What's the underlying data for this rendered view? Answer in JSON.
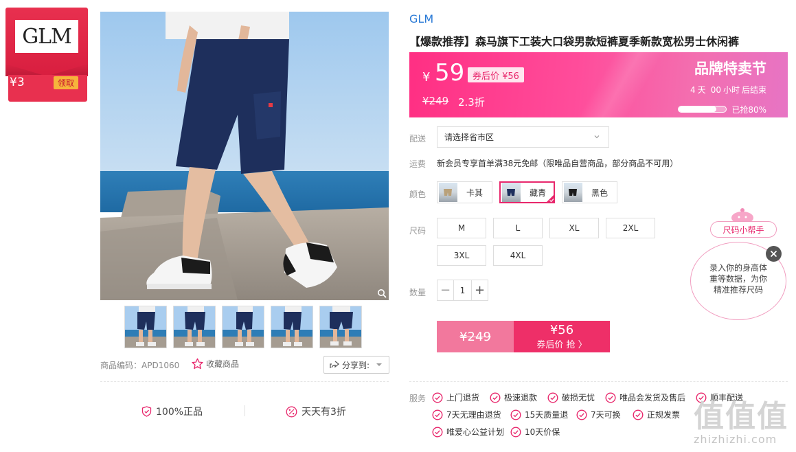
{
  "brand_card": {
    "logo_text": "GLM",
    "coupon_amount": "¥3",
    "coupon_button": "领取"
  },
  "gallery": {
    "thumb_count": 5
  },
  "meta": {
    "product_code": "商品编码：APD1060",
    "favorite": "收藏商品",
    "share": "分享到:"
  },
  "guarantees": {
    "genuine": "100%正品",
    "daily_discount": "天天有3折"
  },
  "product": {
    "brand": "GLM",
    "title": "【爆款推荐】森马旗下工装大口袋男款短裤夏季新款宽松男士休闲裤"
  },
  "price": {
    "yen": "¥",
    "current": "59",
    "coupon_tag": "券后价 ¥56",
    "original": "¥249",
    "discount": "2.3折",
    "event_title": "品牌特卖节",
    "countdown_days": "4",
    "countdown_day_unit": "天",
    "countdown_hours": "00",
    "countdown_hour_unit": "小时",
    "countdown_suffix": "后结束",
    "sold_percent": 0.8,
    "sold_label": "已抢80%"
  },
  "labels": {
    "delivery": "配送",
    "shipping": "运费",
    "color": "颜色",
    "size": "尺码",
    "quantity": "数量",
    "service": "服务"
  },
  "delivery": {
    "placeholder": "请选择省市区"
  },
  "shipping": {
    "text": "新会员专享首单满38元免邮（限唯品自营商品，部分商品不可用）"
  },
  "colors": [
    {
      "label": "卡其",
      "selected": false
    },
    {
      "label": "藏青",
      "selected": true
    },
    {
      "label": "黑色",
      "selected": false
    }
  ],
  "sizes": [
    "M",
    "L",
    "XL",
    "2XL",
    "3XL",
    "4XL"
  ],
  "quantity": {
    "value": "1",
    "minus": "−",
    "plus": "+"
  },
  "buy": {
    "original": "¥249",
    "price": "¥56",
    "label": "券后价 抢 〉"
  },
  "services": [
    "上门退货",
    "极速退款",
    "破损无忧",
    "唯品会发货及售后",
    "顺丰配送",
    "7天无理由退货",
    "15天质量退",
    "7天可换",
    "正规发票",
    "唯爱心公益计划",
    "10天价保"
  ],
  "size_helper": {
    "pill": "尺码小帮手",
    "line1": "录入你的身高体",
    "line2": "重等数据，为你",
    "line3": "精准推荐尺码"
  },
  "watermark": {
    "big": "值值值",
    "small": "zhizhizhi.com"
  },
  "colors_theme": {
    "accent": "#e8276c",
    "brand_red": "#e8304f",
    "link": "#2a7ad6"
  }
}
